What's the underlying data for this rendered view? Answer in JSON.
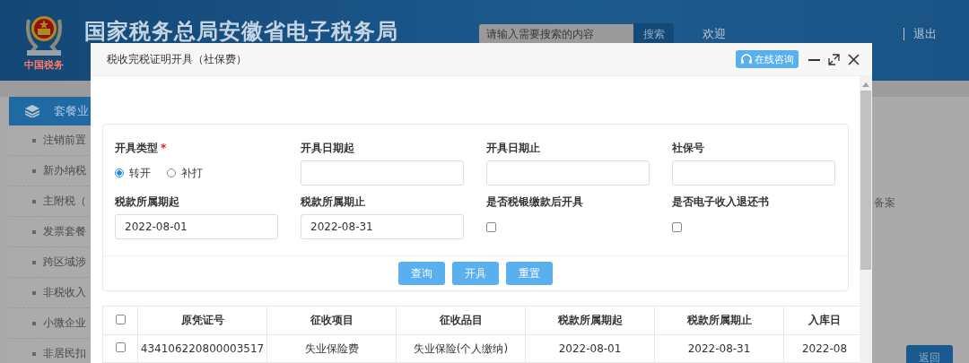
{
  "header": {
    "logo_text": "中国税务",
    "title": "国家税务总局安徽省电子税务局",
    "search": {
      "placeholder": "请输入需要搜索的内容",
      "button": "搜索"
    },
    "welcome": "欢迎",
    "logout": "退出"
  },
  "sidebar": {
    "title": "套餐业",
    "items": [
      "注销前置",
      "新办纳税",
      "主附税（",
      "发票套餐",
      "跨区域涉",
      "非税收入",
      "小微企业",
      "非居民扣"
    ]
  },
  "content": {
    "text": "备案",
    "back_button": "返回"
  },
  "dialog": {
    "title": "税收完税证明开具（社保费）",
    "consult_button": "在线咨询",
    "form": {
      "fields": [
        {
          "kind": "radio",
          "label": "开具类型",
          "required_mark": "*",
          "options": [
            {
              "label": "转开",
              "selected": true
            },
            {
              "label": "补打",
              "selected": false
            }
          ]
        },
        {
          "kind": "input",
          "label": "开具日期起"
        },
        {
          "kind": "input",
          "label": "开具日期止"
        },
        {
          "kind": "input",
          "label": "社保号"
        },
        {
          "kind": "input",
          "label": "税款所属期起",
          "value": "2022-08-01"
        },
        {
          "kind": "input",
          "label": "税款所属期止",
          "value": "2022-08-31"
        },
        {
          "kind": "checkbox",
          "label": "是否税银缴款后开具",
          "checked": false
        },
        {
          "kind": "checkbox",
          "label": "是否电子收入退还书",
          "checked": false
        }
      ],
      "buttons": [
        "查询",
        "开具",
        "重置"
      ]
    },
    "table": {
      "all_checked": false,
      "columns": [
        "原凭证号",
        "征收项目",
        "征收品目",
        "税款所属期起",
        "税款所属期止",
        "入库日"
      ],
      "rows": [
        {
          "checked": false,
          "cells": [
            "434106220800003517",
            "失业保险费",
            "失业保险(个人缴纳)",
            "2022-08-01",
            "2022-08-31",
            "2022-08"
          ]
        }
      ]
    }
  }
}
